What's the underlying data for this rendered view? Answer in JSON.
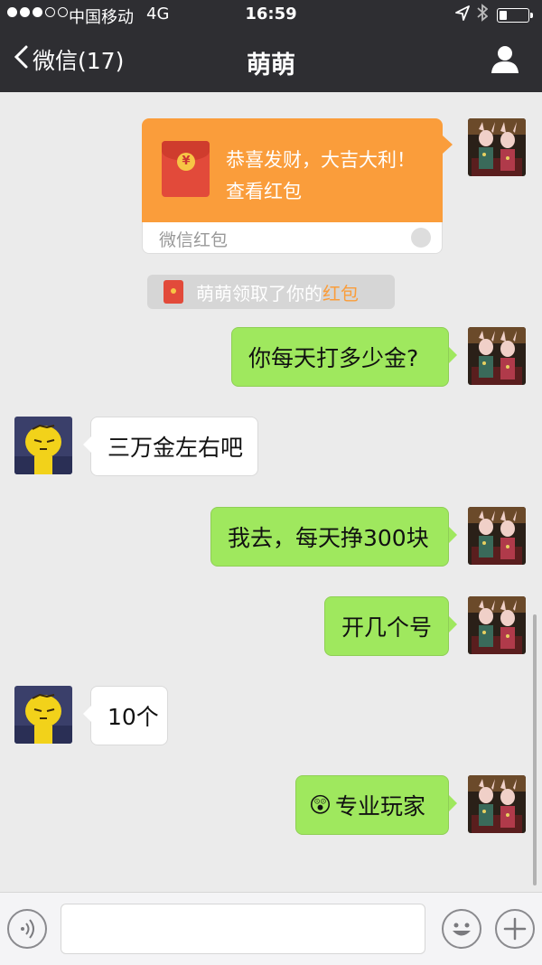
{
  "status_bar": {
    "carrier": "中国移动",
    "network": "4G",
    "time": "16:59",
    "battery_level": 0.3
  },
  "nav": {
    "back_label": "微信(17)",
    "title": "萌萌",
    "back_icon": "chevron-left-icon",
    "profile_icon": "person-icon"
  },
  "red_packet": {
    "greeting": "恭喜发财，大吉大利！",
    "action": "查看红包",
    "label": "微信红包"
  },
  "system_notice": {
    "prefix": "萌萌领取了你的",
    "highlight": "红包"
  },
  "messages": [
    {
      "side": "right",
      "text": "你每天打多少金?"
    },
    {
      "side": "left",
      "text": "三万金左右吧"
    },
    {
      "side": "right",
      "text": "我去，每天挣300块"
    },
    {
      "side": "right",
      "text": "开几个号"
    },
    {
      "side": "left",
      "text": "10个"
    },
    {
      "side": "right",
      "emoji": "😲",
      "text": "专业玩家"
    }
  ],
  "input_bar": {
    "voice_icon": "voice-icon",
    "emoji_icon": "smiley-icon",
    "plus_icon": "plus-icon",
    "value": ""
  },
  "colors": {
    "header_bg": "#2e2e32",
    "chat_bg": "#ebebeb",
    "my_bubble": "#9fe85e",
    "their_bubble": "#ffffff",
    "red_packet": "#fa9d3b"
  }
}
